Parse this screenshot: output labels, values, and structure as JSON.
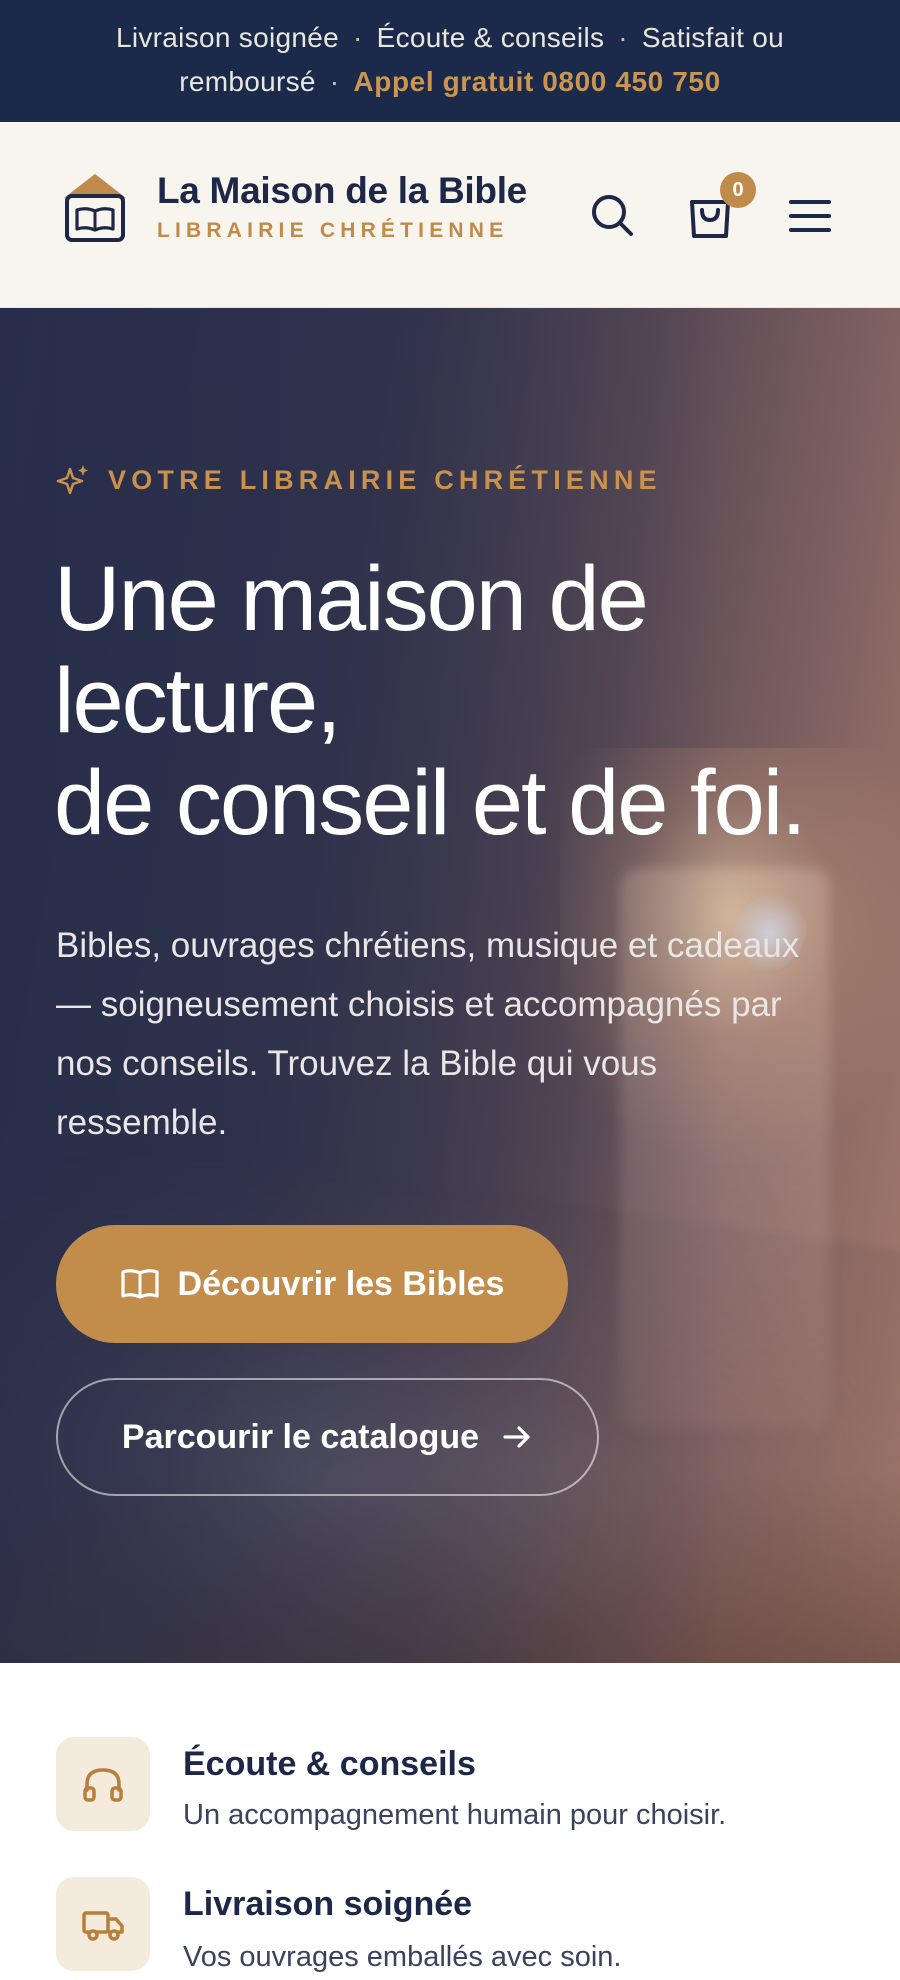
{
  "topbar": {
    "item_1": "Livraison soignée",
    "item_2": "Écoute & conseils",
    "item_3_a": "Satisfait ou",
    "item_3_b": "remboursé",
    "separator": "·",
    "phone": "Appel gratuit 0800 450 750"
  },
  "header": {
    "brand_name": "La Maison de la Bible",
    "brand_tagline": "LIBRAIRIE CHRÉTIENNE",
    "cart_count": "0",
    "icons": [
      "house-book-logo-icon",
      "search-icon",
      "shopping-bag-icon",
      "menu-icon"
    ]
  },
  "hero": {
    "eyebrow": "VOTRE LIBRAIRIE CHRÉTIENNE",
    "title_line_1": "Une maison de",
    "title_line_2": "lecture,",
    "title_line_3": "de conseil et de foi.",
    "text": "Bibles, ouvrages chrétiens, musique et cadeaux — soigneusement choisis et accompagnés par nos conseils. Trouvez la Bible qui vous ressemble.",
    "primary_cta": "Découvrir les Bibles",
    "secondary_cta": "Parcourir le catalogue"
  },
  "features": [
    {
      "title": "Écoute & conseils",
      "desc": "Un accompagnement humain pour choisir.",
      "icon": "headphones-icon"
    },
    {
      "title": "Livraison soignée",
      "desc": "Vos ouvrages emballés avec soin.",
      "icon": "truck-icon"
    }
  ],
  "colors": {
    "navy": "#1b2a4a",
    "gold": "#c28d4b",
    "cream": "#f8f4ee",
    "feature_icon_bg": "#f5ebdc"
  }
}
